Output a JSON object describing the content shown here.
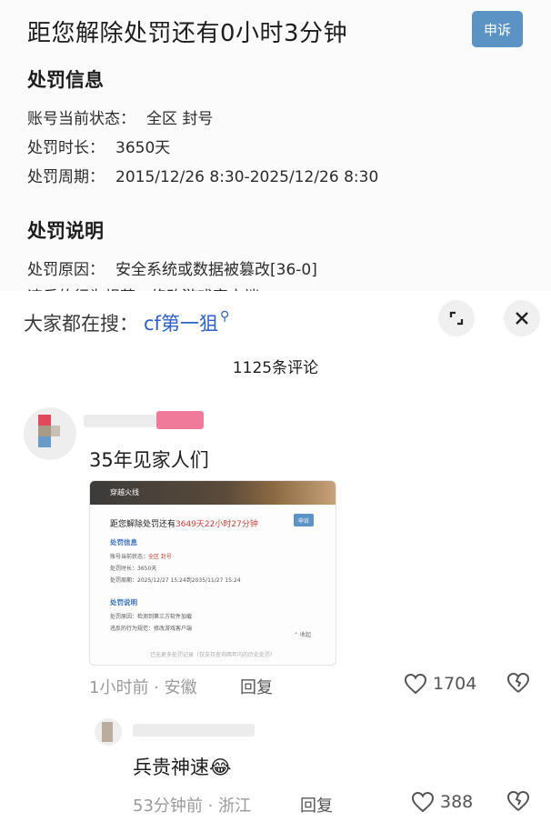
{
  "penalty": {
    "title": "距您解除处罚还有0小时3分钟",
    "appeal_label": "申诉",
    "info_heading": "处罚信息",
    "rows": [
      {
        "label": "账号当前状态：",
        "value": "全区 封号"
      },
      {
        "label": "处罚时长：",
        "value": "3650天"
      },
      {
        "label": "处罚周期：",
        "value": "2015/12/26 8:30-2025/12/26 8:30"
      }
    ],
    "desc_heading": "处罚说明",
    "reason_label": "处罚原因：",
    "reason_value": "安全系统或数据被篡改[36-0]",
    "cut_line": "违反的行为规范：修改游戏客户端"
  },
  "sheet": {
    "hot_search_prefix": "大家都在搜：",
    "hot_search_keyword": "cf第一狙",
    "comment_count": "1125条评论"
  },
  "comments": [
    {
      "text": "35年见家人们",
      "time_location": "1小时前 · 安徽",
      "reply_label": "回复",
      "likes": "1704"
    }
  ],
  "embedded_screenshot": {
    "banner": "穿越火线",
    "title_prefix": "距您解除处罚还有",
    "title_highlight": "3649天22小时27分钟",
    "appeal": "申诉",
    "info_heading": "处罚信息",
    "status": "账号当前状态：",
    "status_value": "全区 封号",
    "duration": "处罚时长：",
    "duration_value": "3650天",
    "period": "处罚周期：",
    "period_value": "2025/12/27 15:24到2035/11/27 15:24",
    "desc_heading": "处罚说明",
    "reason": "处罚原因：",
    "reason_value": "检测到第三方软件加载",
    "rule": "违反的行为规范：",
    "rule_value": "修改游戏客户端",
    "collapse": "收起",
    "footer": "已无更多处罚记录（仅支持查询两年内的历史处罚）"
  },
  "reply": {
    "text": "兵贵神速",
    "emoji": "😂",
    "time_location": "53分钟前 · 浙江",
    "reply_label": "回复",
    "likes": "388"
  },
  "colors": {
    "accent": "#2a62c9",
    "appeal": "#5b93c4",
    "highlight": "#d0403a"
  }
}
